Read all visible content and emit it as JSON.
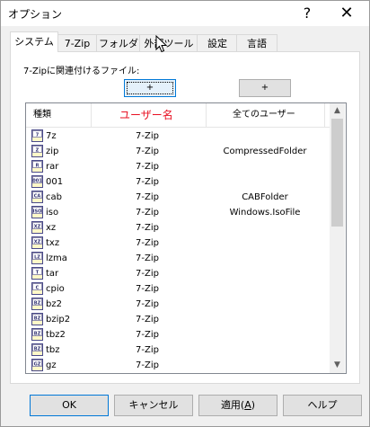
{
  "window": {
    "title": "オプション",
    "help": "?",
    "close": "✕"
  },
  "tabs": [
    {
      "label": "システム"
    },
    {
      "label": "7-Zip"
    },
    {
      "label": "フォルダ"
    },
    {
      "label": "外部ツール"
    },
    {
      "label": "設定"
    },
    {
      "label": "言語"
    }
  ],
  "assoc": {
    "label": "7-Zipに関連付けるファイル:",
    "plus_user": "+",
    "plus_all": "+"
  },
  "list": {
    "headers": {
      "type": "種類",
      "user": "ユーザー名",
      "all": "全てのユーザー"
    },
    "rows": [
      {
        "icon": "7",
        "ext": "7z",
        "user": "7-Zip",
        "all": ""
      },
      {
        "icon": "Z",
        "ext": "zip",
        "user": "7-Zip",
        "all": "CompressedFolder"
      },
      {
        "icon": "R",
        "ext": "rar",
        "user": "7-Zip",
        "all": ""
      },
      {
        "icon": "001",
        "ext": "001",
        "user": "7-Zip",
        "all": ""
      },
      {
        "icon": "CA",
        "ext": "cab",
        "user": "7-Zip",
        "all": "CABFolder"
      },
      {
        "icon": "ISO",
        "ext": "iso",
        "user": "7-Zip",
        "all": "Windows.IsoFile"
      },
      {
        "icon": "XZ",
        "ext": "xz",
        "user": "7-Zip",
        "all": ""
      },
      {
        "icon": "XZ",
        "ext": "txz",
        "user": "7-Zip",
        "all": ""
      },
      {
        "icon": "LZ",
        "ext": "lzma",
        "user": "7-Zip",
        "all": ""
      },
      {
        "icon": "T",
        "ext": "tar",
        "user": "7-Zip",
        "all": ""
      },
      {
        "icon": "C",
        "ext": "cpio",
        "user": "7-Zip",
        "all": ""
      },
      {
        "icon": "BZ",
        "ext": "bz2",
        "user": "7-Zip",
        "all": ""
      },
      {
        "icon": "BZ",
        "ext": "bzip2",
        "user": "7-Zip",
        "all": ""
      },
      {
        "icon": "BZ",
        "ext": "tbz2",
        "user": "7-Zip",
        "all": ""
      },
      {
        "icon": "BZ",
        "ext": "tbz",
        "user": "7-Zip",
        "all": ""
      },
      {
        "icon": "GZ",
        "ext": "gz",
        "user": "7-Zip",
        "all": ""
      }
    ]
  },
  "buttons": {
    "ok": "OK",
    "cancel": "キャンセル",
    "apply_prefix": "適用(",
    "apply_key": "A",
    "apply_suffix": ")",
    "help": "ヘルプ"
  },
  "colors": {
    "accent": "#0078d7",
    "header_red": "#e81123",
    "icon_fill": "#fff8c8",
    "icon_stroke": "#4a4a8a"
  },
  "icons": {
    "scroll_up": "scroll-up-arrow-icon",
    "scroll_down": "scroll-down-arrow-icon",
    "file": "archive-file-icon",
    "cursor": "mouse-pointer-icon"
  }
}
